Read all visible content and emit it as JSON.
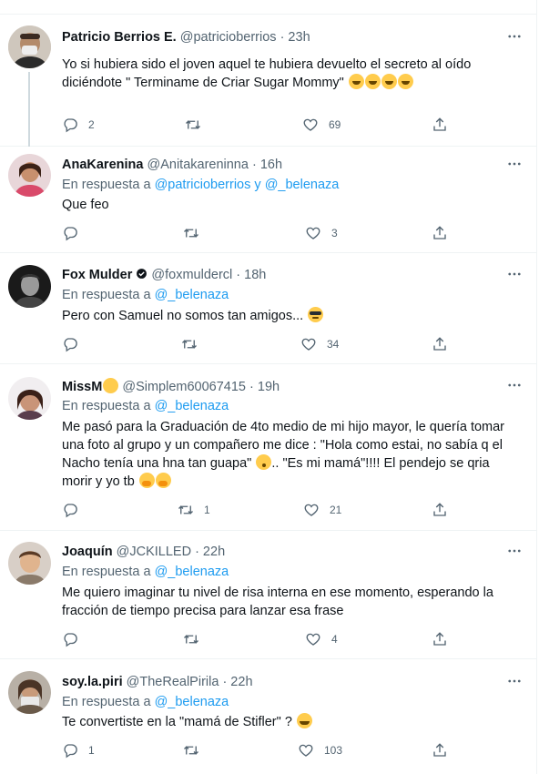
{
  "tweets": [
    {
      "name": "Patricio Berrios E.",
      "handle": "@patricioberrios",
      "time": "· 23h",
      "reply_prefix": "",
      "reply_to": "",
      "reply_and": "",
      "reply_to2": "",
      "text": "Yo si hubiera sido el joven aquel te hubiera devuelto el secreto al oído diciéndote \" Terminame de Criar Sugar Mommy\"",
      "emoji": [
        "rolling-on-floor-laughing",
        "rolling-on-floor-laughing",
        "rolling-on-floor-laughing",
        "rolling-on-floor-laughing"
      ],
      "replies": "2",
      "retweets": "",
      "likes": "69"
    },
    {
      "name": "AnaKarenina",
      "handle": "@Anitakareninna",
      "time": "· 16h",
      "reply_prefix": "En respuesta a",
      "reply_to": "@patricioberrios",
      "reply_and": "y",
      "reply_to2": "@_belenaza",
      "text": "Que feo",
      "emoji": [],
      "replies": "",
      "retweets": "",
      "likes": "3"
    },
    {
      "name": "Fox Mulder",
      "handle": "@foxmuldercl",
      "time": "· 18h",
      "reply_prefix": "En respuesta a",
      "reply_to": "@_belenaza",
      "text": "Pero con Samuel no somos tan amigos...",
      "emoji": [
        "smiling-face-with-sunglasses"
      ],
      "replies": "",
      "retweets": "",
      "likes": "34"
    },
    {
      "name": "MissM",
      "handle": "@Simplem60067415",
      "time": "· 19h",
      "reply_prefix": "En respuesta a",
      "reply_to": "@_belenaza",
      "text_lines": [
        "Me pasó para la Graduación de 4to medio de mi hijo mayor, le quería tomar",
        "una foto al grupo y un compañero me dice : \"Hola como estai, no sabía q el",
        "Nacho tenía una hna tan guapa\"",
        ".. \"Es mi mamá\"!!!! El pendejo se qria",
        "morir y yo tb"
      ],
      "emoji": [
        "smiling-face-with-hearts",
        "flushed-face",
        "face-with-hand-over-mouth",
        "face-with-hand-over-mouth"
      ],
      "replies": "",
      "retweets": "1",
      "likes": "21"
    },
    {
      "name": "Joaquín",
      "handle": "@JCKILLED",
      "time": "· 22h",
      "reply_prefix": "En respuesta a",
      "reply_to": "@_belenaza",
      "text": "Me quiero imaginar tu nivel de risa interna en ese momento, esperando la fracción de tiempo precisa para lanzar esa frase",
      "emoji": [],
      "replies": "",
      "retweets": "",
      "likes": "4"
    },
    {
      "name": "soy.la.piri",
      "handle": "@TheRealPirila",
      "time": "· 22h",
      "reply_prefix": "En respuesta a",
      "reply_to": "@_belenaza",
      "text": "Te convertiste en la \"mamá de Stifler\" ?",
      "emoji": [
        "grinning-squinting-face-with-sweat"
      ],
      "replies": "1",
      "retweets": "",
      "likes": "103"
    }
  ],
  "colors": {
    "link": "#1d9bf0",
    "muted": "#536471",
    "text": "#0f1419",
    "border": "#eff3f4"
  },
  "icons": [
    "reply-icon",
    "retweet-icon",
    "like-icon",
    "share-icon",
    "more-icon",
    "verified-icon"
  ]
}
